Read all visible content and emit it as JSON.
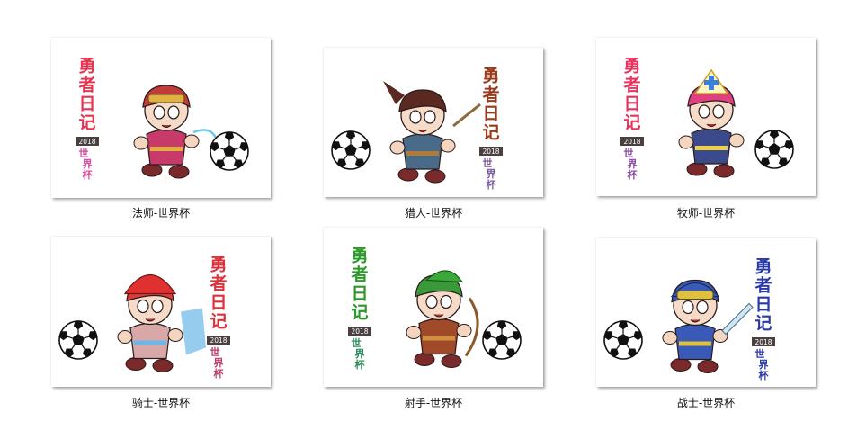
{
  "tiles": [
    {
      "caption": "法师-世界杯",
      "title_chars": [
        "勇",
        "者",
        "日",
        "记"
      ],
      "year": "2018",
      "subtitle_chars": [
        "世",
        "界",
        "杯"
      ],
      "title_color": "#e8334f",
      "subtitle_color": "#d84aa0",
      "text_side": "left",
      "ball_side": "right",
      "character": "mage",
      "hair_color": "#c33a3a",
      "outfit_color": "#c73a6a",
      "accent_color": "#e0b040"
    },
    {
      "caption": "猎人-世界杯",
      "title_chars": [
        "勇",
        "者",
        "日",
        "记"
      ],
      "year": "2018",
      "subtitle_chars": [
        "世",
        "界",
        "杯"
      ],
      "title_color": "#9a3a1a",
      "subtitle_color": "#7a5a9a",
      "text_side": "right",
      "ball_side": "left",
      "character": "hunter",
      "hair_color": "#5a2a22",
      "outfit_color": "#4a6a8a",
      "accent_color": "#b07a3a"
    },
    {
      "caption": "牧师-世界杯",
      "title_chars": [
        "勇",
        "者",
        "日",
        "记"
      ],
      "year": "2018",
      "subtitle_chars": [
        "世",
        "界",
        "杯"
      ],
      "title_color": "#e8335f",
      "subtitle_color": "#8a4aa0",
      "text_side": "left",
      "ball_side": "right",
      "character": "priest",
      "hair_color": "#e04080",
      "outfit_color": "#3a4a8a",
      "accent_color": "#f0d040"
    },
    {
      "caption": "骑士-世界杯",
      "title_chars": [
        "勇",
        "者",
        "日",
        "记"
      ],
      "year": "2018",
      "subtitle_chars": [
        "世",
        "界",
        "杯"
      ],
      "title_color": "#e0303a",
      "subtitle_color": "#c03a6a",
      "text_side": "right",
      "ball_side": "left",
      "character": "knight",
      "hair_color": "#e03a3a",
      "outfit_color": "#d8a8a8",
      "accent_color": "#6ab8e8"
    },
    {
      "caption": "射手-世界杯",
      "title_chars": [
        "勇",
        "者",
        "日",
        "记"
      ],
      "year": "2018",
      "subtitle_chars": [
        "世",
        "界",
        "杯"
      ],
      "title_color": "#2a9a2a",
      "subtitle_color": "#2a8a5a",
      "text_side": "left",
      "ball_side": "right",
      "character": "archer",
      "hair_color": "#3a9a3a",
      "outfit_color": "#a04a2a",
      "accent_color": "#d09040"
    },
    {
      "caption": "战士-世界杯",
      "title_chars": [
        "勇",
        "者",
        "日",
        "记"
      ],
      "year": "2018",
      "subtitle_chars": [
        "世",
        "界",
        "杯"
      ],
      "title_color": "#2a3aa8",
      "subtitle_color": "#2a3aa8",
      "text_side": "right",
      "ball_side": "left",
      "character": "warrior",
      "hair_color": "#3a5ab8",
      "outfit_color": "#3a5ab8",
      "accent_color": "#e0c040"
    }
  ]
}
